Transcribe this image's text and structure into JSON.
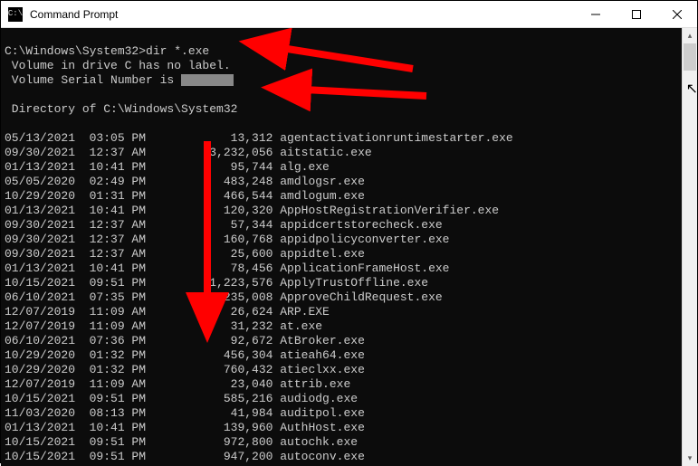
{
  "window": {
    "title": "Command Prompt",
    "icon_text": "C:\\"
  },
  "terminal": {
    "prompt": "C:\\Windows\\System32>",
    "command": "dir *.exe",
    "volume_line": " Volume in drive C has no label.",
    "serial_prefix": " Volume Serial Number is ",
    "directory_line": " Directory of C:\\Windows\\System32",
    "files": [
      {
        "date": "05/13/2021",
        "time": "03:05 PM",
        "size": "13,312",
        "name": "agentactivationruntimestarter.exe"
      },
      {
        "date": "09/30/2021",
        "time": "12:37 AM",
        "size": "3,232,056",
        "name": "aitstatic.exe"
      },
      {
        "date": "01/13/2021",
        "time": "10:41 PM",
        "size": "95,744",
        "name": "alg.exe"
      },
      {
        "date": "05/05/2020",
        "time": "02:49 PM",
        "size": "483,248",
        "name": "amdlogsr.exe"
      },
      {
        "date": "10/29/2020",
        "time": "01:31 PM",
        "size": "466,544",
        "name": "amdlogum.exe"
      },
      {
        "date": "01/13/2021",
        "time": "10:41 PM",
        "size": "120,320",
        "name": "AppHostRegistrationVerifier.exe"
      },
      {
        "date": "09/30/2021",
        "time": "12:37 AM",
        "size": "57,344",
        "name": "appidcertstorecheck.exe"
      },
      {
        "date": "09/30/2021",
        "time": "12:37 AM",
        "size": "160,768",
        "name": "appidpolicyconverter.exe"
      },
      {
        "date": "09/30/2021",
        "time": "12:37 AM",
        "size": "25,600",
        "name": "appidtel.exe"
      },
      {
        "date": "01/13/2021",
        "time": "10:41 PM",
        "size": "78,456",
        "name": "ApplicationFrameHost.exe"
      },
      {
        "date": "10/15/2021",
        "time": "09:51 PM",
        "size": "1,223,576",
        "name": "ApplyTrustOffline.exe"
      },
      {
        "date": "06/10/2021",
        "time": "07:35 PM",
        "size": "235,008",
        "name": "ApproveChildRequest.exe"
      },
      {
        "date": "12/07/2019",
        "time": "11:09 AM",
        "size": "26,624",
        "name": "ARP.EXE"
      },
      {
        "date": "12/07/2019",
        "time": "11:09 AM",
        "size": "31,232",
        "name": "at.exe"
      },
      {
        "date": "06/10/2021",
        "time": "07:36 PM",
        "size": "92,672",
        "name": "AtBroker.exe"
      },
      {
        "date": "10/29/2020",
        "time": "01:32 PM",
        "size": "456,304",
        "name": "atieah64.exe"
      },
      {
        "date": "10/29/2020",
        "time": "01:32 PM",
        "size": "760,432",
        "name": "atieclxx.exe"
      },
      {
        "date": "12/07/2019",
        "time": "11:09 AM",
        "size": "23,040",
        "name": "attrib.exe"
      },
      {
        "date": "10/15/2021",
        "time": "09:51 PM",
        "size": "585,216",
        "name": "audiodg.exe"
      },
      {
        "date": "11/03/2020",
        "time": "08:13 PM",
        "size": "41,984",
        "name": "auditpol.exe"
      },
      {
        "date": "01/13/2021",
        "time": "10:41 PM",
        "size": "139,960",
        "name": "AuthHost.exe"
      },
      {
        "date": "10/15/2021",
        "time": "09:51 PM",
        "size": "972,800",
        "name": "autochk.exe"
      },
      {
        "date": "10/15/2021",
        "time": "09:51 PM",
        "size": "947,200",
        "name": "autoconv.exe"
      }
    ]
  }
}
